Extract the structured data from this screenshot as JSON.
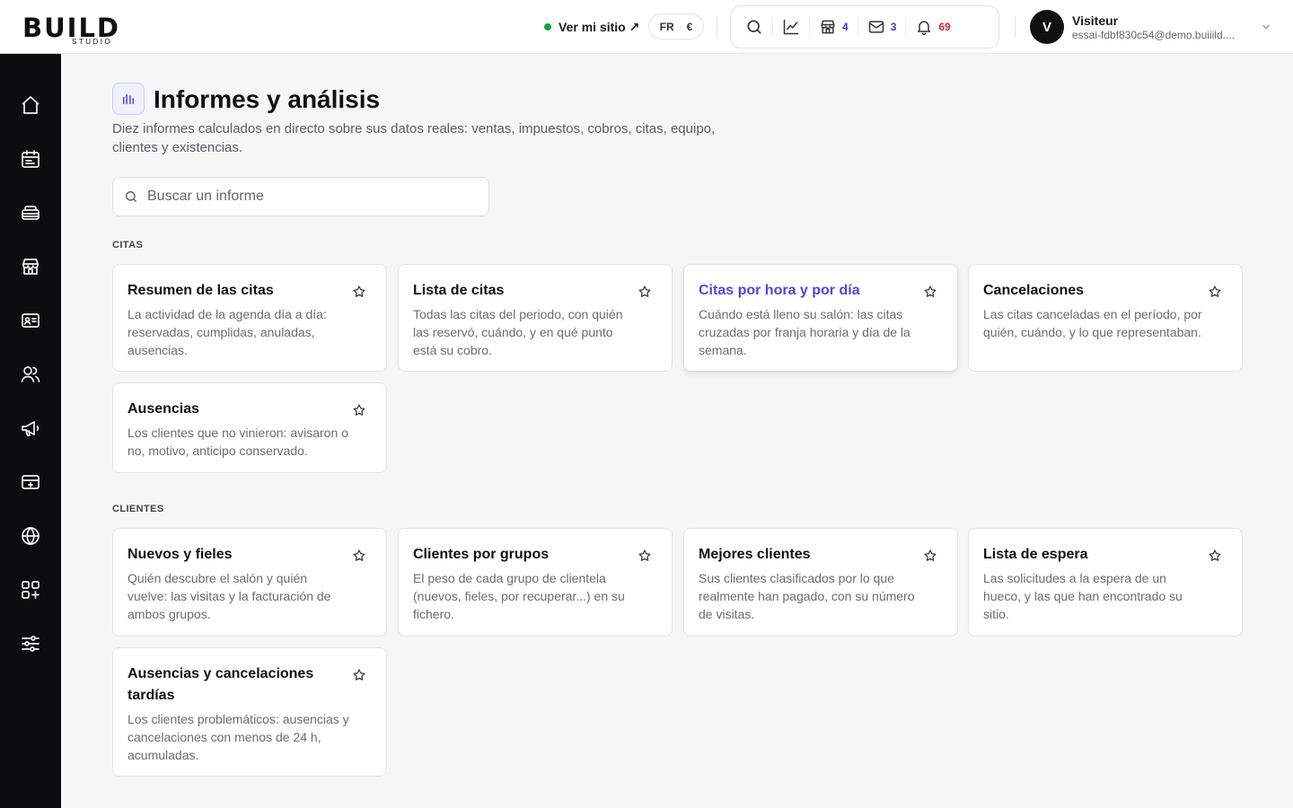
{
  "brand": {
    "logo_text": "BUILD",
    "logo_sub": "STUDIO"
  },
  "header": {
    "site_link": "Ver mi sitio ↗",
    "lang": "FR",
    "currency": "€",
    "counts": {
      "shop": "4",
      "mail": "3",
      "notifications": "69"
    }
  },
  "user": {
    "initial": "V",
    "name": "Visiteur",
    "email": "essai-fdbf830c54@demo.buiiild...."
  },
  "page": {
    "title": "Informes y análisis",
    "description": "Diez informes calculados en directo sobre sus datos reales: ventas, impuestos, cobros, citas, equipo, clientes y existencias.",
    "search_placeholder": "Buscar un informe"
  },
  "sections": [
    {
      "label": "CITAS",
      "cards": [
        {
          "title": "Resumen de las citas",
          "desc": "La actividad de la agenda día a día: reservadas, cumplidas, anuladas, ausencias."
        },
        {
          "title": "Lista de citas",
          "desc": "Todas las citas del periodo, con quién las reservó, cuándo, y en qué punto está su cobro."
        },
        {
          "title": "Citas por hora y por día",
          "desc": "Cuándo está lleno su salón: las citas cruzadas por franja horaria y día de la semana."
        },
        {
          "title": "Cancelaciones",
          "desc": "Las citas canceladas en el período, por quién, cuándo, y lo que representaban."
        },
        {
          "title": "Ausencias",
          "desc": "Los clientes que no vinieron: avisaron o no, motivo, anticipo conservado."
        }
      ]
    },
    {
      "label": "CLIENTES",
      "cards": [
        {
          "title": "Nuevos y fieles",
          "desc": "Quién descubre el salón y quién vuelve: las visitas y la facturación de ambos grupos."
        },
        {
          "title": "Clientes por grupos",
          "desc": "El peso de cada grupo de clientela (nuevos, fieles, por recuperar...) en su fichero."
        },
        {
          "title": "Mejores clientes",
          "desc": "Sus clientes clasificados por lo que realmente han pagado, con su número de visitas."
        },
        {
          "title": "Lista de espera",
          "desc": "Las solicitudes a la espera de un hueco, y las que han encontrado su sitio."
        },
        {
          "title": "Ausencias y cancelaciones tardías",
          "desc": "Los clientes problemáticos: ausencias y cancelaciones con menos de 24 h, acumuladas."
        }
      ]
    }
  ],
  "colors": {
    "accent": "#4f46e5",
    "sidebar": "#0d0d0f",
    "online": "#16a34a",
    "alert": "#dc2626"
  }
}
